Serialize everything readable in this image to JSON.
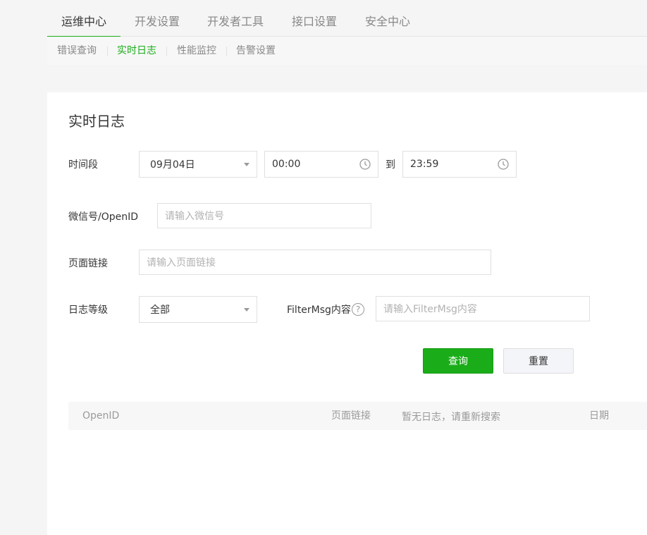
{
  "top_tabs": [
    "运维中心",
    "开发设置",
    "开发者工具",
    "接口设置",
    "安全中心"
  ],
  "sub_tabs": [
    "错误查询",
    "实时日志",
    "性能监控",
    "告警设置"
  ],
  "card": {
    "title": "实时日志",
    "time": {
      "label": "时间段",
      "date": "09月04日",
      "start": "00:00",
      "to": "到",
      "end": "23:59"
    },
    "openid": {
      "label": "微信号/OpenID",
      "placeholder": "请输入微信号"
    },
    "page_url": {
      "label": "页面链接",
      "placeholder": "请输入页面链接"
    },
    "level": {
      "label": "日志等级",
      "value": "全部"
    },
    "filter_msg": {
      "label": "FilterMsg内容",
      "help": "?",
      "placeholder": "请输入FilterMsg内容"
    },
    "buttons": {
      "query": "查询",
      "reset": "重置"
    },
    "table": {
      "columns": [
        "OpenID",
        "页面链接",
        "日期"
      ],
      "empty_text": "暂无日志，请重新搜索"
    }
  },
  "colors": {
    "accent": "#1aad19",
    "muted": "#888888",
    "border": "#e0e0e0"
  }
}
